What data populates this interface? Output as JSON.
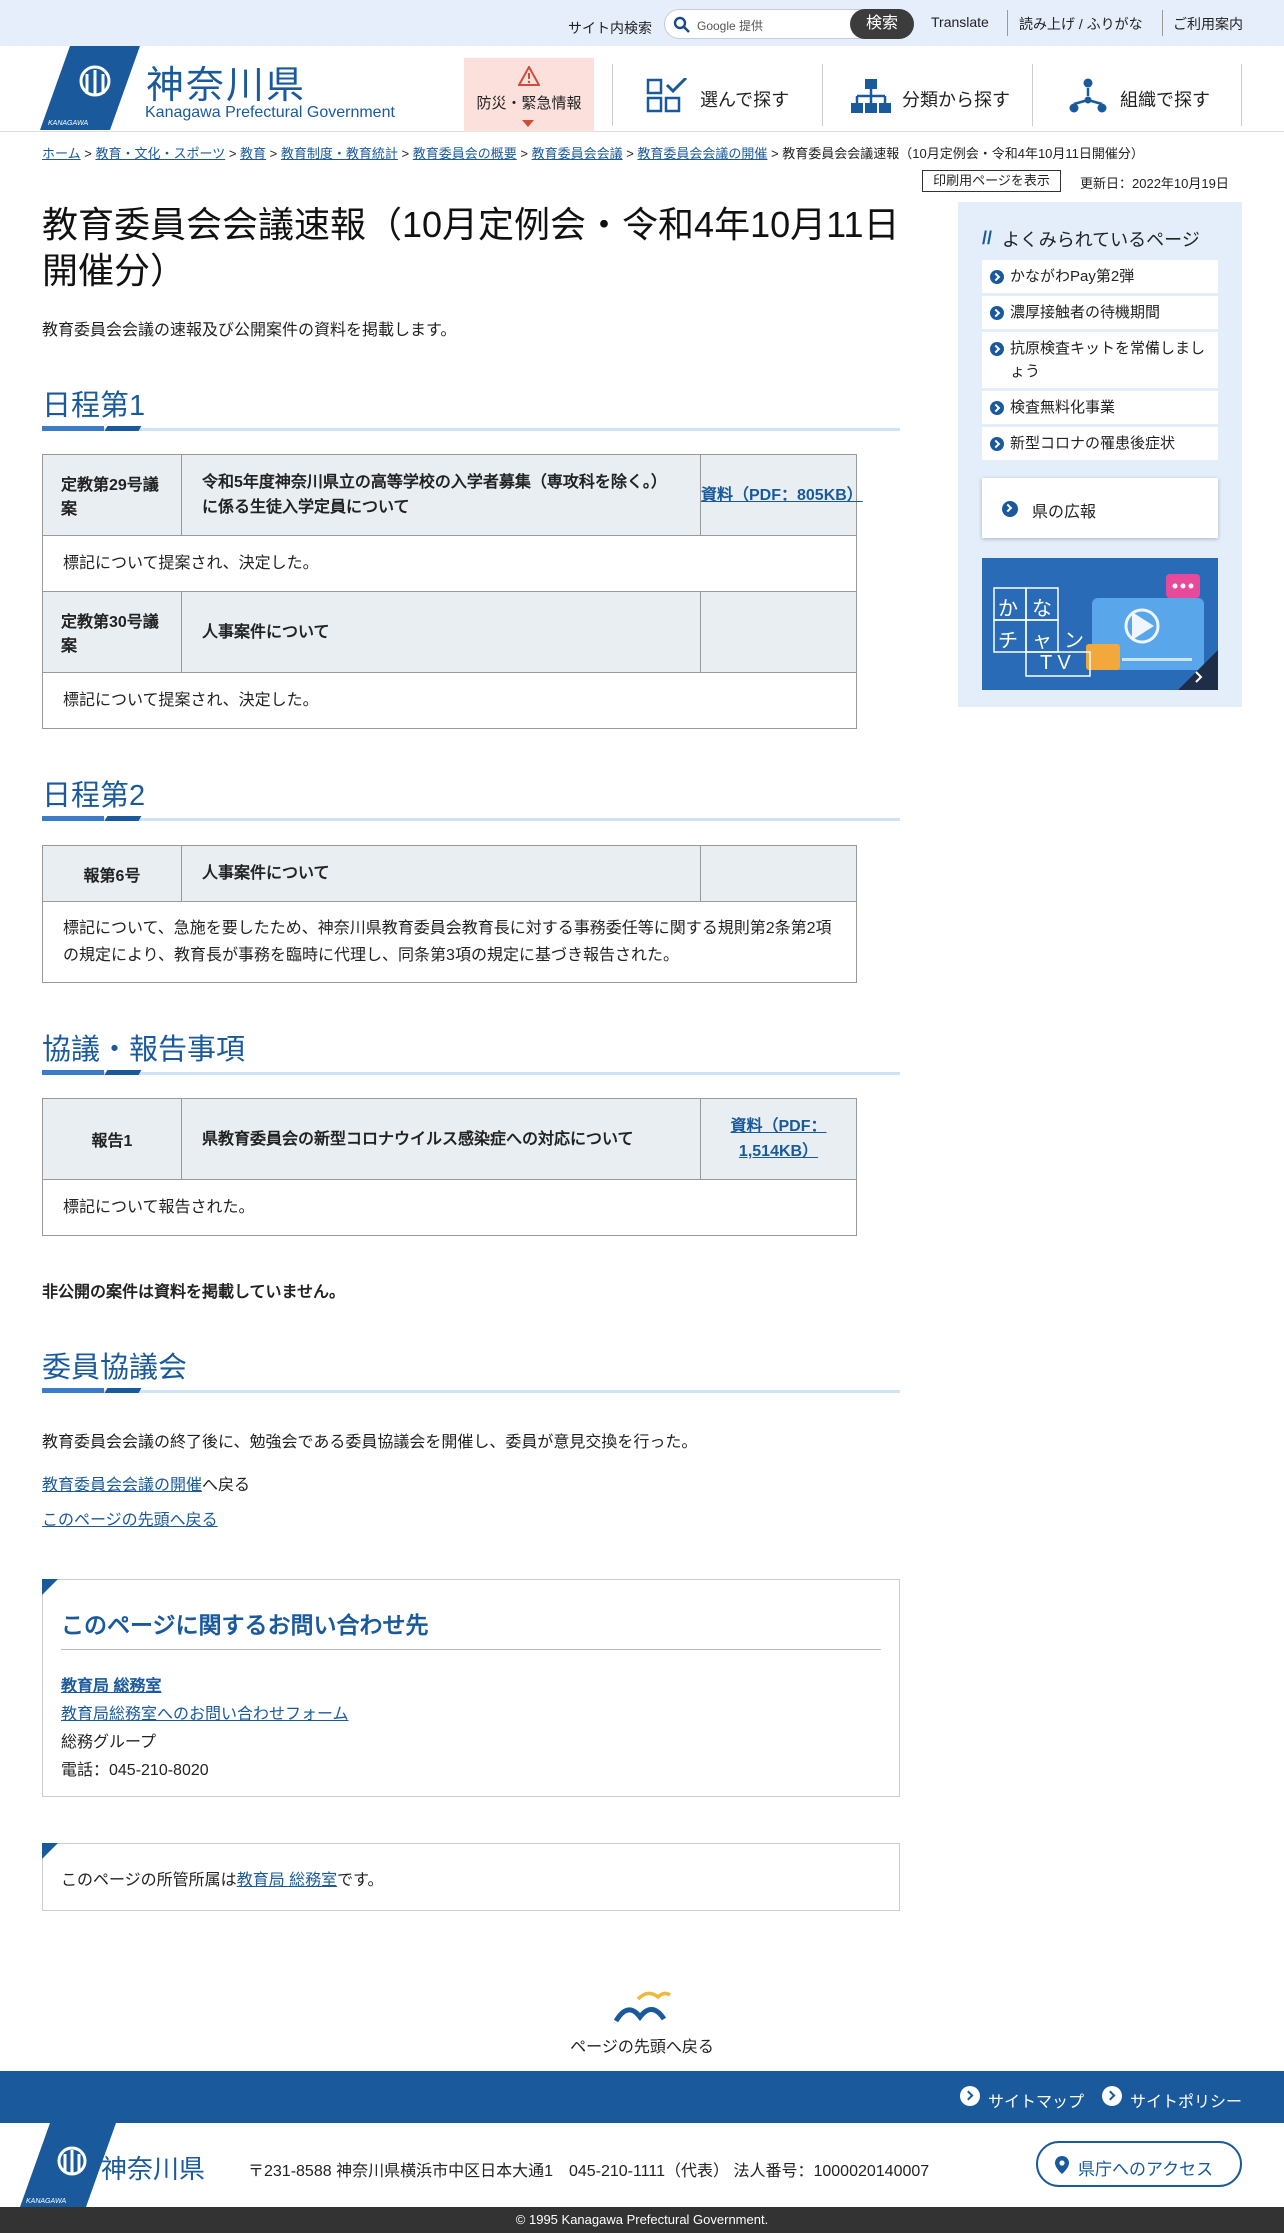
{
  "utility": {
    "site_search_label": "サイト内検索",
    "search_placeholder": "Google 提供",
    "search_button": "検索",
    "links": [
      "Translate",
      "読み上げ / ふりがな",
      "ご利用案内"
    ]
  },
  "header": {
    "logo_jp": "神奈川県",
    "logo_en": "Kanagawa Prefectural Government",
    "logo_small": "KANAGAWA",
    "emergency": "防災・緊急情報",
    "nav": [
      "選んで探す",
      "分類から探す",
      "組織で探す"
    ]
  },
  "breadcrumb": {
    "links": [
      "ホーム",
      "教育・文化・スポーツ",
      "教育",
      "教育制度・教育統計",
      "教育委員会の概要",
      "教育委員会会議",
      "教育委員会会議の開催"
    ],
    "current": "教育委員会会議速報（10月定例会・令和4年10月11日開催分）"
  },
  "print_button": "印刷用ページを表示",
  "updated": "更新日：2022年10月19日",
  "page": {
    "title": "教育委員会会議速報（10月定例会・令和4年10月11日開催分）",
    "lead": "教育委員会会議の速報及び公開案件の資料を掲載します。"
  },
  "sections": {
    "s1": {
      "heading": "日程第1",
      "rows": [
        {
          "no": "定教第29号議案",
          "title": "令和5年度神奈川県立の高等学校の入学者募集（専攻科を除く。）に係る生徒入学定員について",
          "doc": "資料（PDF：805KB）",
          "result": "標記について提案され、決定した。"
        },
        {
          "no": "定教第30号議案",
          "title": "人事案件について",
          "doc": "",
          "result": "標記について提案され、決定した。"
        }
      ]
    },
    "s2": {
      "heading": "日程第2",
      "rows": [
        {
          "no": "報第6号",
          "title": "人事案件について",
          "doc": "",
          "result": "標記について、急施を要したため、神奈川県教育委員会教育長に対する事務委任等に関する規則第2条第2項の規定により、教育長が事務を臨時に代理し、同条第3項の規定に基づき報告された。"
        }
      ]
    },
    "s3": {
      "heading": "協議・報告事項",
      "rows": [
        {
          "no": "報告1",
          "title": "県教育委員会の新型コロナウイルス感染症への対応について",
          "doc": "資料（PDF：1,514KB）",
          "result": "標記について報告された。"
        }
      ]
    },
    "note": "非公開の案件は資料を掲載していません。",
    "s4": {
      "heading": "委員協議会",
      "text": "教育委員会会議の終了後に、勉強会である委員協議会を開催し、委員が意見交換を行った。"
    }
  },
  "back_links": {
    "meeting_link": "教育委員会会議の開催",
    "meeting_suffix": "へ戻る",
    "top_link": "このページの先頭へ戻る"
  },
  "contact": {
    "heading": "このページに関するお問い合わせ先",
    "dept": "教育局 総務室",
    "form": "教育局総務室へのお問い合わせフォーム",
    "group": "総務グループ",
    "phone": "電話：045-210-8020"
  },
  "owner": {
    "prefix": "このページの所管所属は",
    "dept": "教育局 総務室",
    "suffix": "です。"
  },
  "sidebar": {
    "heading": "よくみられているページ",
    "items": [
      "かながわPay第2弾",
      "濃厚接触者の待機期間",
      "抗原検査キットを常備しましょう",
      "検査無料化事業",
      "新型コロナの罹患後症状"
    ],
    "kouhou": "県の広報",
    "banner_chars": [
      "か",
      "な",
      "チ",
      "ャ",
      "ン",
      "T V"
    ]
  },
  "to_top": "ページの先頭へ戻る",
  "footer": {
    "links": [
      "サイトマップ",
      "サイトポリシー"
    ],
    "name": "神奈川県",
    "address": "〒231-8588 神奈川県横浜市中区日本大通1　045-210-1111（代表） 法人番号：1000020140007",
    "access": "県庁へのアクセス",
    "copyright": "© 1995 Kanagawa Prefectural Government."
  },
  "colors": {
    "brand": "#1a5a9c",
    "emergency_bg": "#fbe0dc",
    "topbar_bg": "#e6eefb"
  }
}
